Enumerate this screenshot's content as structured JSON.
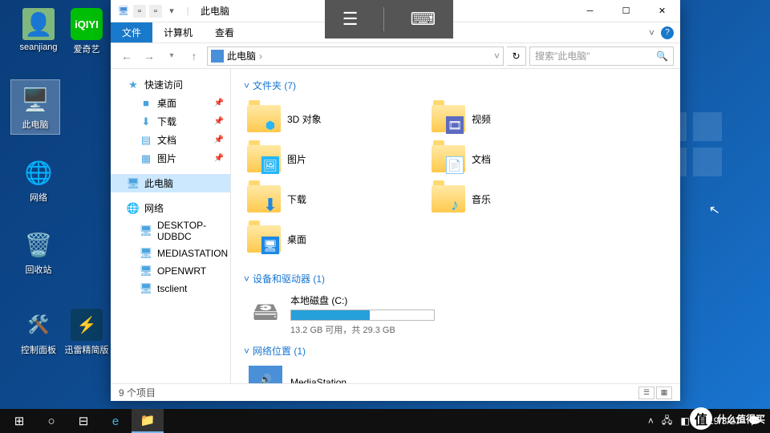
{
  "desktop_icons": {
    "user": "seanjiang",
    "iqiyi": "爱奇艺",
    "thispc": "此电脑",
    "network": "网络",
    "recycle": "回收站",
    "control": "控制面板",
    "thunder": "迅雷精简版"
  },
  "window": {
    "title": "此电脑",
    "ribbon": {
      "file": "文件",
      "computer": "计算机",
      "view": "查看"
    },
    "nav": {
      "path": "此电脑",
      "search_placeholder": "搜索\"此电脑\""
    },
    "sidebar": {
      "quick": "快速访问",
      "desktop": "桌面",
      "downloads": "下载",
      "documents": "文档",
      "pictures": "图片",
      "thispc": "此电脑",
      "network": "网络",
      "n1": "DESKTOP-UDBDC",
      "n2": "MEDIASTATION",
      "n3": "OPENWRT",
      "n4": "tsclient"
    },
    "groups": {
      "folders": "文件夹 (7)",
      "devices": "设备和驱动器 (1)",
      "network": "网络位置 (1)"
    },
    "folders": {
      "objects3d": "3D 对象",
      "videos": "视频",
      "pictures": "图片",
      "documents": "文档",
      "downloads": "下载",
      "music": "音乐",
      "desktop": "桌面"
    },
    "drive": {
      "name": "本地磁盘 (C:)",
      "info": "13.2 GB 可用，共 29.3 GB",
      "used_pct": 55
    },
    "netloc": {
      "name": "MediaStation"
    },
    "status": "9 个项目"
  },
  "taskbar": {
    "date": "2019/3/27"
  },
  "watermark": "什么值得买"
}
